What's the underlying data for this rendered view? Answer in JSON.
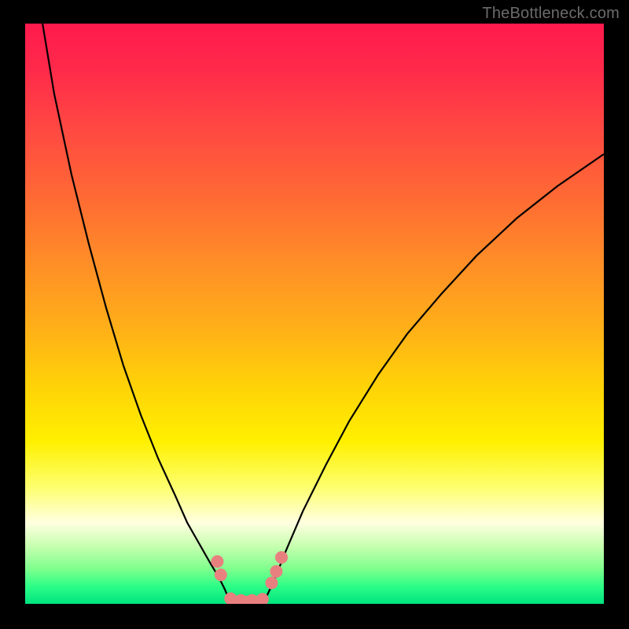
{
  "watermark": "TheBottleneck.com",
  "colors": {
    "frame": "#000000",
    "gradient_top": "#ff1a4d",
    "gradient_bottom": "#00e47f",
    "curve": "#000000",
    "marker": "#e98080"
  },
  "chart_data": {
    "type": "line",
    "title": "",
    "xlabel": "",
    "ylabel": "",
    "xlim": [
      0,
      100
    ],
    "ylim": [
      0,
      100
    ],
    "grid": false,
    "legend": false,
    "series": [
      {
        "name": "left_curve",
        "x": [
          3,
          5,
          8,
          11,
          14,
          17,
          20,
          23,
          26,
          28,
          30,
          32,
          33.5,
          34.5,
          35.2
        ],
        "y": [
          100,
          88,
          74,
          62,
          51,
          41,
          32.5,
          25,
          18.5,
          14,
          10.5,
          7,
          4.5,
          2.5,
          0.8
        ]
      },
      {
        "name": "right_curve",
        "x": [
          41.5,
          43,
          45,
          48,
          52,
          56,
          61,
          66,
          72,
          78,
          85,
          92,
          100
        ],
        "y": [
          0.8,
          4,
          9,
          16,
          24,
          31.5,
          39.5,
          46.5,
          53.5,
          60,
          66.5,
          72,
          77.5
        ]
      },
      {
        "name": "floor",
        "x": [
          35.2,
          41.5
        ],
        "y": [
          0.5,
          0.5
        ]
      }
    ],
    "markers": [
      {
        "series": "left_curve",
        "x": 33.2,
        "y": 7.3
      },
      {
        "series": "left_curve",
        "x": 33.8,
        "y": 5.0
      },
      {
        "series": "floor",
        "x": 35.5,
        "y": 0.9
      },
      {
        "series": "floor",
        "x": 37.3,
        "y": 0.6
      },
      {
        "series": "floor",
        "x": 39.2,
        "y": 0.6
      },
      {
        "series": "floor",
        "x": 41.0,
        "y": 0.8
      },
      {
        "series": "right_curve",
        "x": 42.6,
        "y": 3.6
      },
      {
        "series": "right_curve",
        "x": 43.4,
        "y": 5.6
      },
      {
        "series": "right_curve",
        "x": 44.3,
        "y": 8.0
      }
    ],
    "floor_segment": {
      "x0": 34.8,
      "x1": 42.0,
      "y": 0.6,
      "thickness": 1.6
    }
  }
}
